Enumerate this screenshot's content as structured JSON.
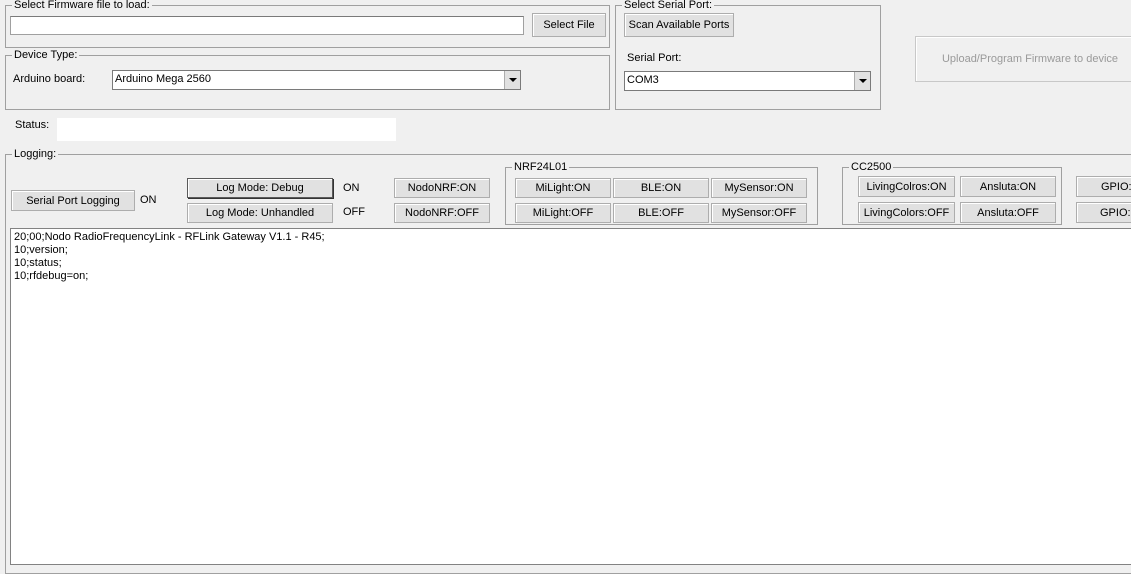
{
  "firmware": {
    "legend": "Select Firmware file to load:",
    "file_path": "",
    "select_file_label": "Select File"
  },
  "device": {
    "legend": "Device Type:",
    "board_label": "Arduino board:",
    "board_value": "Arduino Mega 2560"
  },
  "serial": {
    "legend": "Select Serial Port:",
    "scan_label": "Scan Available Ports",
    "port_label": "Serial Port:",
    "port_value": "COM3"
  },
  "upload": {
    "label": "Upload/Program Firmware to device"
  },
  "status": {
    "label": "Status:",
    "value": ""
  },
  "logging": {
    "legend": "Logging:",
    "serial_port_logging_label": "Serial Port Logging",
    "serial_port_logging_state": "ON",
    "log_mode_debug_label": "Log Mode: Debug",
    "log_mode_debug_state": "ON",
    "log_mode_unhandled_label": "Log Mode: Unhandled",
    "log_mode_unhandled_state": "OFF",
    "nodonrf_on": "NodoNRF:ON",
    "nodonrf_off": "NodoNRF:OFF"
  },
  "nrf": {
    "legend": "NRF24L01",
    "milight_on": "MiLight:ON",
    "ble_on": "BLE:ON",
    "mysensor_on": "MySensor:ON",
    "milight_off": "MiLight:OFF",
    "ble_off": "BLE:OFF",
    "mysensor_off": "MySensor:OFF"
  },
  "cc2500": {
    "legend": "CC2500",
    "livingcolros_on": "LivingColros:ON",
    "ansluta_on": "Ansluta:ON",
    "livingcolors_off": "LivingColors:OFF",
    "ansluta_off": "Ansluta:OFF"
  },
  "gpio": {
    "on_label": "GPIO:",
    "off_label": "GPIO:("
  },
  "log_lines": [
    "20;00;Nodo RadioFrequencyLink - RFLink Gateway V1.1 - R45;",
    "10;version;",
    "10;status;",
    "10;rfdebug=on;"
  ]
}
